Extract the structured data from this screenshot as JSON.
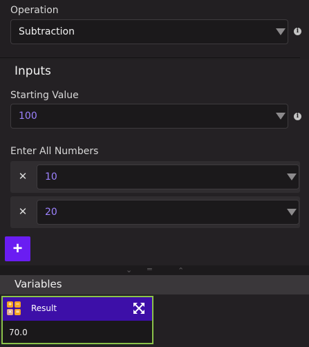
{
  "operation": {
    "label": "Operation",
    "value": "Subtraction",
    "info_icon": "i"
  },
  "inputs": {
    "title": "Inputs",
    "starting_value": {
      "label": "Starting Value",
      "value": "100",
      "info_icon": "i"
    },
    "numbers": {
      "label": "Enter All Numbers",
      "items": [
        {
          "value": "10",
          "remove_glyph": "✕"
        },
        {
          "value": "20",
          "remove_glyph": "✕"
        }
      ],
      "add_glyph": "+"
    }
  },
  "resize_handle": {
    "collapse_glyph": "⌄",
    "drag_glyph": "═",
    "expand_glyph": "⌃"
  },
  "variables": {
    "title": "Variables",
    "cards": [
      {
        "name": "Result",
        "value": "70.0",
        "icon": "calculator-icon"
      }
    ]
  },
  "colors": {
    "accent": "#6a1df2",
    "card_header": "#3d0fa8",
    "card_border": "#8bc34a",
    "value_text": "#9d82ff"
  }
}
